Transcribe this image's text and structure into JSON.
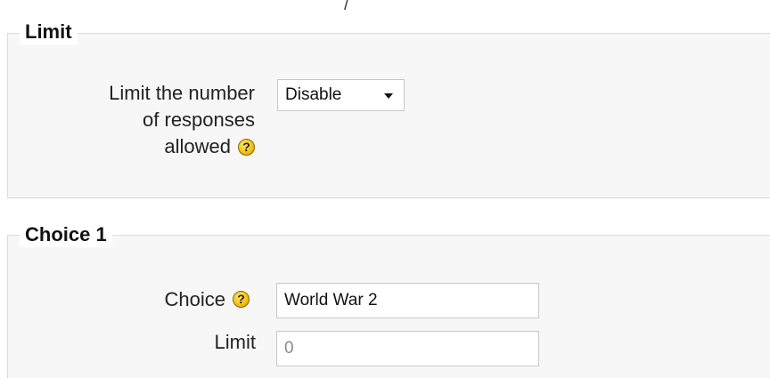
{
  "sections": {
    "limit": {
      "legend": "Limit",
      "limit_responses_label": "Limit the number of responses allowed",
      "limit_responses_lines": [
        "Limit the number",
        "of responses",
        "allowed"
      ],
      "select_value": "Disable"
    },
    "choice1": {
      "legend": "Choice 1",
      "choice_label": "Choice",
      "choice_value": "World War 2",
      "limit_label": "Limit",
      "limit_value": "0"
    }
  },
  "icons": {
    "help_icon_glyph": "?",
    "help_icon_color": "#f4c21a"
  }
}
